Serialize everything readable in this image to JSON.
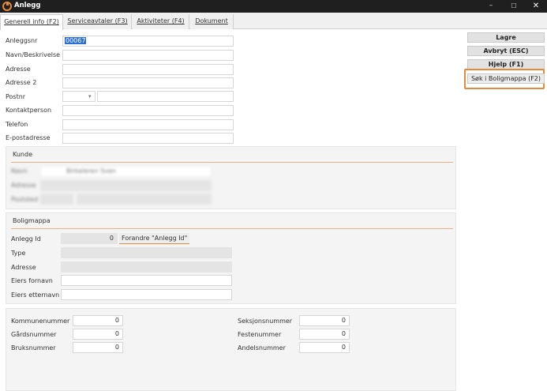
{
  "window": {
    "title": "Anlegg",
    "minimize_glyph": "–",
    "maximize_glyph": "☐",
    "close_glyph": "✕"
  },
  "tabs": [
    {
      "label": "Generell info (F2)",
      "active": true
    },
    {
      "label": "Serviceavtaler (F3)",
      "active": false
    },
    {
      "label": "Aktiviteter (F4)",
      "active": false
    },
    {
      "label": "Dokument",
      "active": false
    }
  ],
  "buttons": {
    "save": "Lagre",
    "cancel": "Avbryt (ESC)",
    "help": "Hjelp (F1)",
    "search_boligmappa": "Søk i Boligmappa (F2)"
  },
  "general": {
    "anleggsnr_label": "Anleggsnr",
    "anleggsnr_value": "00067",
    "navn_label": "Navn/Beskrivelse",
    "adresse_label": "Adresse",
    "adresse2_label": "Adresse 2",
    "postnr_label": "Postnr",
    "kontaktperson_label": "Kontaktperson",
    "telefon_label": "Telefon",
    "epost_label": "E-postadresse"
  },
  "kunde": {
    "title": "Kunde",
    "navn_label": "Navn",
    "navn_value": "Birkeleren Sven",
    "adresse_label": "Adresse",
    "postsed_label": "Poststed"
  },
  "boligmappa": {
    "title": "Boligmappa",
    "anlegg_id_label": "Anlegg Id",
    "anlegg_id_value": "0",
    "change_id_button": "Forandre \"Anlegg Id\"",
    "type_label": "Type",
    "adresse_label": "Adresse",
    "eiers_fornavn_label": "Eiers fornavn",
    "eiers_etternavn_label": "Eiers etternavn"
  },
  "numbers": {
    "kommunenummer_label": "Kommunenummer",
    "kommunenummer_value": "0",
    "gardsnummer_label": "Gårdsnummer",
    "gardsnummer_value": "0",
    "bruksnummer_label": "Bruksnummer",
    "bruksnummer_value": "0",
    "seksjonsnummer_label": "Seksjonsnummer",
    "seksjonsnummer_value": "0",
    "festenummer_label": "Festenummer",
    "festenummer_value": "0",
    "andelsnummer_label": "Andelsnummer",
    "andelsnummer_value": "0"
  },
  "colors": {
    "accent": "#e58a3a",
    "titlebar": "#1f1f1f",
    "selection": "#2b6fd4"
  }
}
